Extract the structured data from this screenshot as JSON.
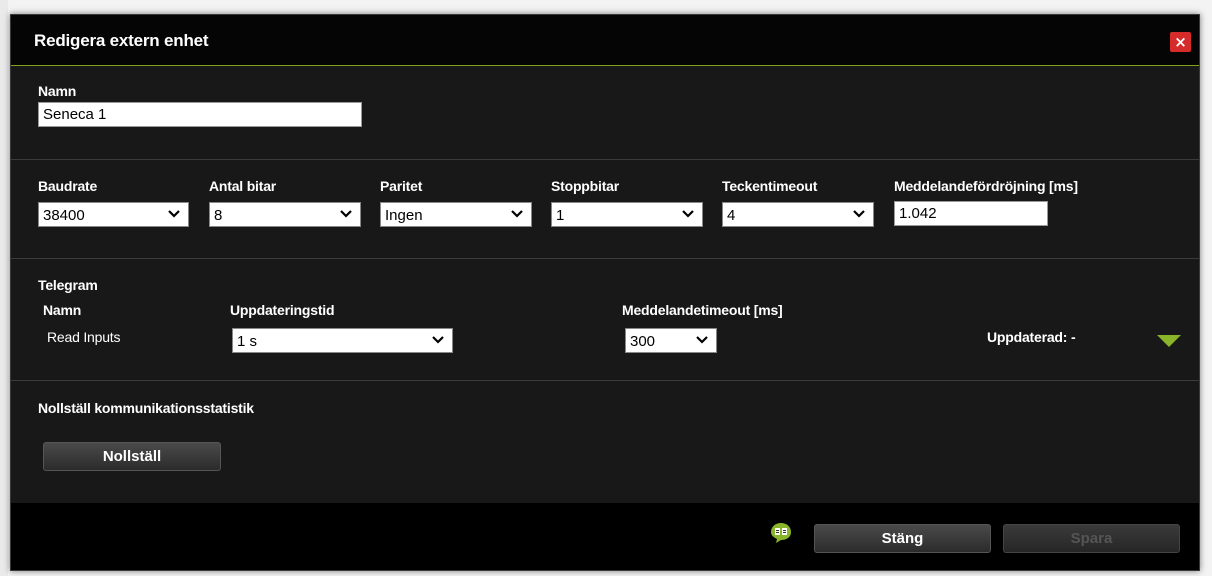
{
  "dialog": {
    "title": "Redigera extern enhet",
    "close_label": "×"
  },
  "name": {
    "label": "Namn",
    "value": "Seneca 1"
  },
  "serial": {
    "baudrate": {
      "label": "Baudrate",
      "value": "38400"
    },
    "bits": {
      "label": "Antal bitar",
      "value": "8"
    },
    "parity": {
      "label": "Paritet",
      "value": "Ingen"
    },
    "stopbits": {
      "label": "Stoppbitar",
      "value": "1"
    },
    "char_timeout": {
      "label": "Teckentimeout",
      "value": "4"
    },
    "msg_delay": {
      "label": "Meddelandefördröjning [ms]",
      "value": "1.042"
    }
  },
  "telegram": {
    "heading": "Telegram",
    "col_name": "Namn",
    "col_update": "Uppdateringstid",
    "col_timeout": "Meddelandetimeout [ms]",
    "rows": [
      {
        "name": "Read Inputs",
        "update": "1 s",
        "timeout": "300",
        "updated": "Uppdaterad: -"
      }
    ]
  },
  "reset": {
    "heading": "Nollställ kommunikationsstatistik",
    "button": "Nollställ"
  },
  "footer": {
    "close_button": "Stäng",
    "save_button": "Spara"
  },
  "colors": {
    "accent": "#8ab52a",
    "close": "#d52b2b",
    "background": "#181818"
  },
  "icons": {
    "help": "help-book-icon",
    "expand": "expand-triangle-icon",
    "dropdown": "chevron-down-icon"
  }
}
